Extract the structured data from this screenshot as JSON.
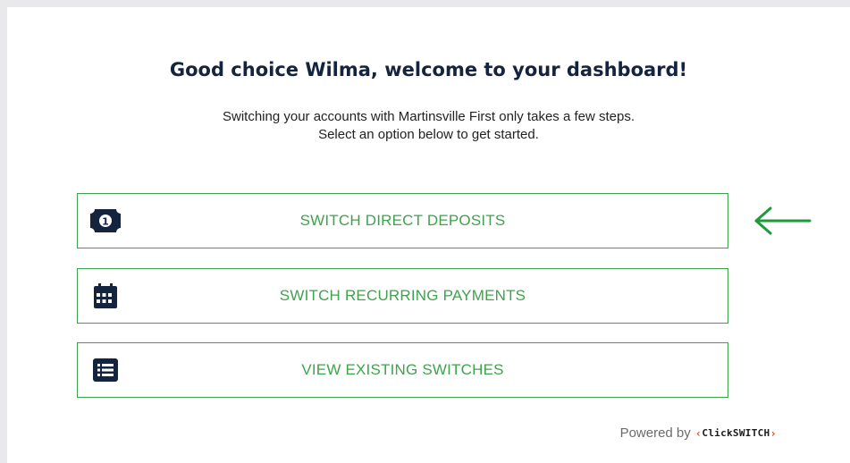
{
  "dashboard": {
    "title": "Good choice Wilma, welcome to your dashboard!",
    "subtitle_line1": "Switching your accounts with Martinsville First only takes a few steps.",
    "subtitle_line2": "Select an option below to get started."
  },
  "options": [
    {
      "label": "SWITCH DIRECT DEPOSITS",
      "icon": "money-bill-icon"
    },
    {
      "label": "SWITCH RECURRING PAYMENTS",
      "icon": "calendar-icon"
    },
    {
      "label": "VIEW EXISTING SWITCHES",
      "icon": "list-icon"
    }
  ],
  "footer": {
    "powered_by": "Powered by",
    "brand_left": "‹",
    "brand_name": "ClickSWITCH",
    "brand_right": "›"
  },
  "colors": {
    "accent_green": "#3fa34d",
    "title_navy": "#14243f",
    "icon_navy": "#14243f",
    "brand_chevron": "#e0451f"
  },
  "annotation": {
    "icon": "left-arrow-icon"
  }
}
